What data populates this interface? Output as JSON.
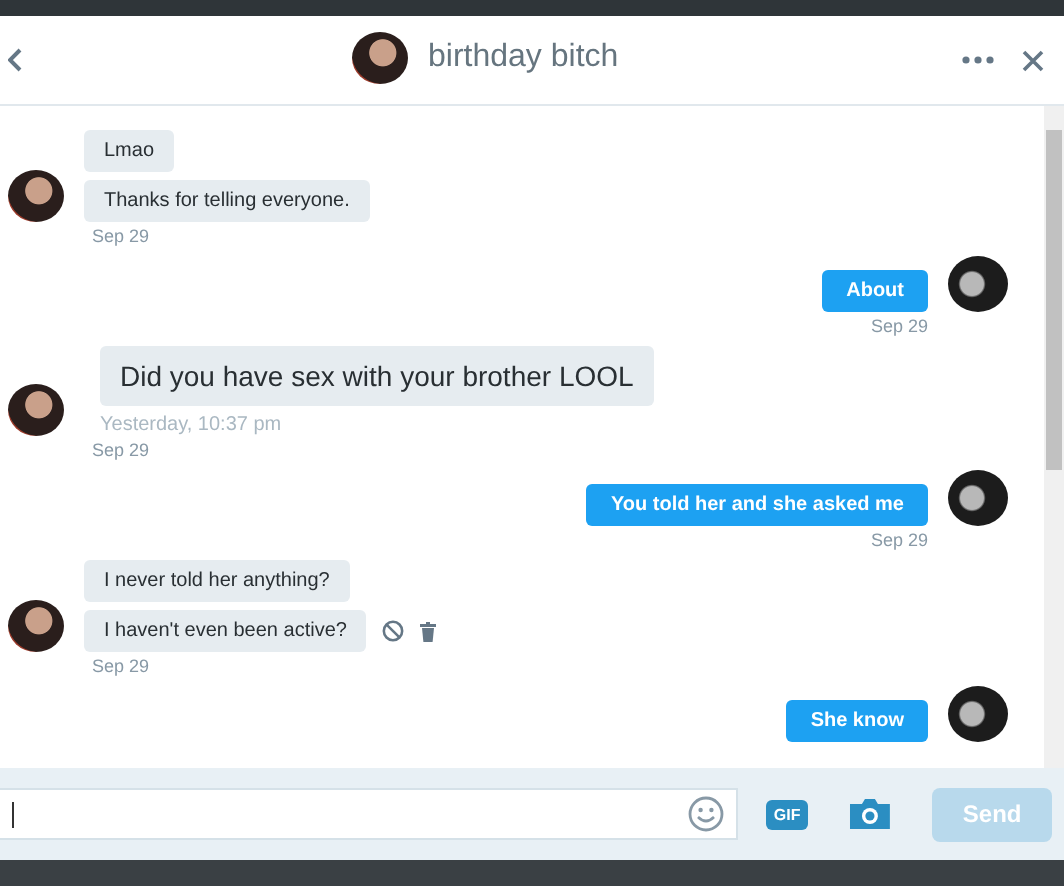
{
  "header": {
    "title": "birthday bitch"
  },
  "messages": [
    {
      "kind": "received",
      "bubbles": [
        {
          "text": "Lmao",
          "kind": "normal"
        },
        {
          "text": "Thanks for telling everyone.",
          "kind": "normal"
        }
      ],
      "time": "Sep 29"
    },
    {
      "kind": "sent",
      "bubbles": [
        {
          "text": "About",
          "kind": "normal"
        }
      ],
      "time": "Sep 29"
    },
    {
      "kind": "received",
      "bubbles": [
        {
          "text": "Did you have sex with your brother LOOL",
          "kind": "large",
          "caption": "Yesterday, 10:37 pm"
        }
      ],
      "time": "Sep 29"
    },
    {
      "kind": "sent",
      "bubbles": [
        {
          "text": "You told her and she asked me",
          "kind": "normal"
        }
      ],
      "time": "Sep 29"
    },
    {
      "kind": "received",
      "bubbles": [
        {
          "text": "I never told her anything?",
          "kind": "normal"
        },
        {
          "text": "I haven't even been active?",
          "kind": "normal"
        }
      ],
      "time": "Sep 29",
      "show_actions": true
    },
    {
      "kind": "sent",
      "bubbles": [
        {
          "text": "She know",
          "kind": "normal"
        }
      ]
    }
  ],
  "composer": {
    "gif_label": "GIF",
    "send_label": "Send",
    "send_disabled": true
  }
}
